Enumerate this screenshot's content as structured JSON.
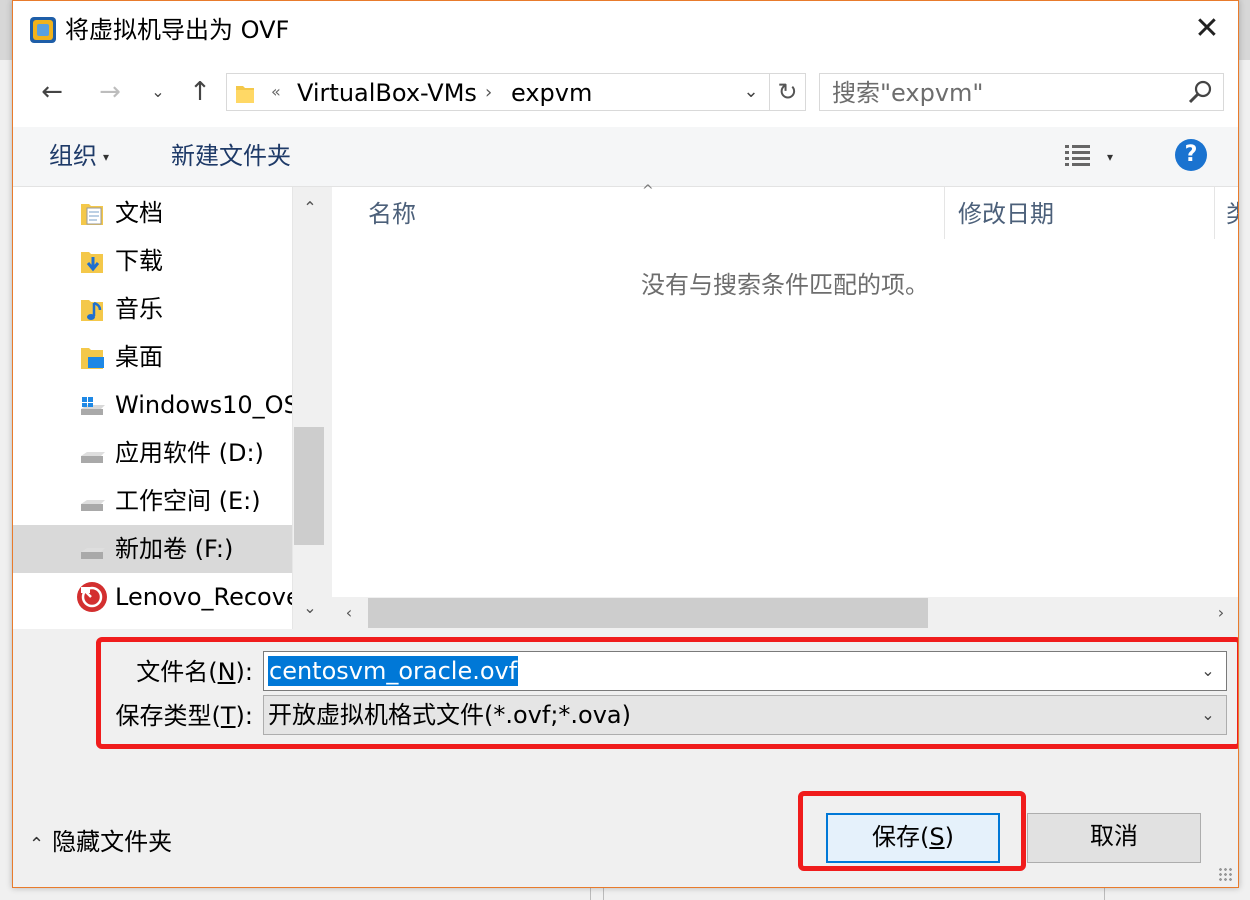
{
  "window": {
    "title": "将虚拟机导出为 OVF",
    "close_glyph": "✕"
  },
  "nav": {
    "back_glyph": "←",
    "forward_glyph": "→",
    "recent_glyph": "⌄",
    "up_glyph": "↑",
    "address": {
      "overflow_glyph": "«",
      "crumbs": [
        "VirtualBox-VMs",
        "expvm"
      ],
      "sep_glyph": "›",
      "dropdown_glyph": "⌄",
      "refresh_glyph": "↻"
    },
    "search": {
      "placeholder": "搜索\"expvm\""
    }
  },
  "toolbar": {
    "organize": "组织",
    "organize_caret": "▾",
    "new_folder": "新建文件夹",
    "view_caret": "▾",
    "help": "?"
  },
  "tree": {
    "items": [
      {
        "label": "文档",
        "icon": "documents-folder-icon",
        "selected": false
      },
      {
        "label": "下载",
        "icon": "downloads-folder-icon",
        "selected": false
      },
      {
        "label": "音乐",
        "icon": "music-folder-icon",
        "selected": false
      },
      {
        "label": "桌面",
        "icon": "desktop-folder-icon",
        "selected": false
      },
      {
        "label": "Windows10_OS",
        "icon": "windows-drive-icon",
        "selected": false
      },
      {
        "label": "应用软件 (D:)",
        "icon": "drive-icon",
        "selected": false
      },
      {
        "label": "工作空间 (E:)",
        "icon": "drive-icon",
        "selected": false
      },
      {
        "label": "新加卷 (F:)",
        "icon": "drive-icon",
        "selected": true
      },
      {
        "label": "Lenovo_Recove",
        "icon": "recovery-drive-icon",
        "selected": false
      }
    ],
    "scroll_up": "⌃",
    "scroll_down": "⌄"
  },
  "filelist": {
    "sort_glyph": "^",
    "columns": [
      "名称",
      "修改日期",
      "类"
    ],
    "empty_message": "没有与搜索条件匹配的项。",
    "scroll_left": "‹",
    "scroll_right": "›"
  },
  "form": {
    "filename_label_pre": "文件名(",
    "filename_label_key": "N",
    "filename_label_post": "):",
    "filename_value": "centosvm_oracle.ovf",
    "filetype_label_pre": "保存类型(",
    "filetype_label_key": "T",
    "filetype_label_post": "):",
    "filetype_value": "开放虚拟机格式文件(*.ovf;*.ova)",
    "dropdown_glyph": "⌄"
  },
  "footer": {
    "hide_folders": "隐藏文件夹",
    "hide_chevron": "⌃",
    "save_pre": "保存(",
    "save_key": "S",
    "save_post": ")",
    "cancel": "取消"
  },
  "colors": {
    "highlight": "#f01c1c",
    "accent": "#0078d7",
    "selection": "#d9d9d9",
    "title_border": "#e87b2c"
  }
}
